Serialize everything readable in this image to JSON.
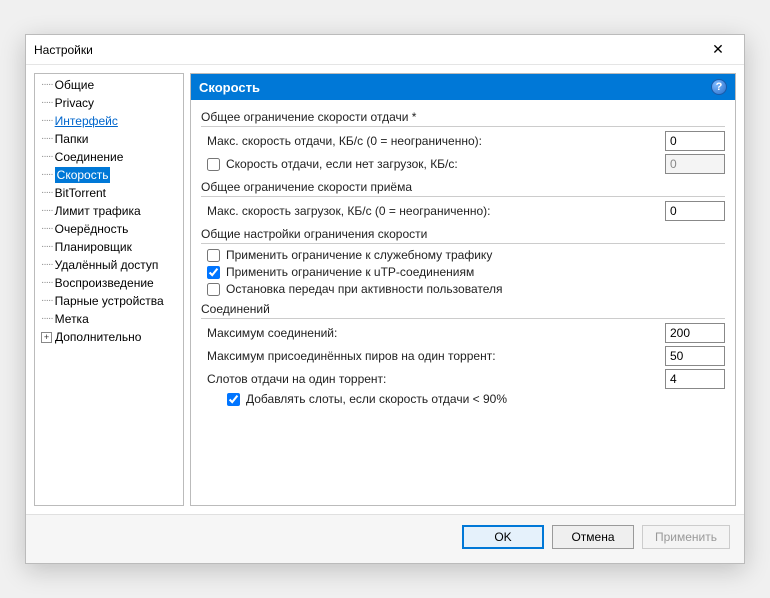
{
  "window": {
    "title": "Настройки",
    "close_glyph": "✕"
  },
  "tree": {
    "items": [
      {
        "label": "Общие",
        "kind": "normal"
      },
      {
        "label": "Privacy",
        "kind": "normal"
      },
      {
        "label": "Интерфейс",
        "kind": "link"
      },
      {
        "label": "Папки",
        "kind": "normal"
      },
      {
        "label": "Соединение",
        "kind": "normal"
      },
      {
        "label": "Скорость",
        "kind": "selected"
      },
      {
        "label": "BitTorrent",
        "kind": "normal"
      },
      {
        "label": "Лимит трафика",
        "kind": "normal"
      },
      {
        "label": "Очерёдность",
        "kind": "normal"
      },
      {
        "label": "Планировщик",
        "kind": "normal"
      },
      {
        "label": "Удалённый доступ",
        "kind": "normal"
      },
      {
        "label": "Воспроизведение",
        "kind": "normal"
      },
      {
        "label": "Парные устройства",
        "kind": "normal"
      },
      {
        "label": "Метка",
        "kind": "normal"
      },
      {
        "label": "Дополнительно",
        "kind": "expandable"
      }
    ]
  },
  "panel": {
    "title": "Скорость",
    "help_glyph": "?",
    "groups": {
      "upload": {
        "title": "Общее ограничение скорости отдачи *",
        "max_label": "Макс. скорость отдачи, КБ/с (0 = неограниченно):",
        "max_value": "0",
        "alt_checkbox_label": "Скорость отдачи, если нет загрузок, КБ/с:",
        "alt_checked": false,
        "alt_value": "0"
      },
      "download": {
        "title": "Общее ограничение скорости приёма",
        "max_label": "Макс. скорость загрузок, КБ/с (0 = неограниченно):",
        "max_value": "0"
      },
      "settings": {
        "title": "Общие настройки ограничения скорости",
        "overhead_label": "Применить ограничение к служебному трафику",
        "overhead_checked": false,
        "utp_label": "Применить ограничение к uTP-соединениям",
        "utp_checked": true,
        "pause_label": "Остановка передач при активности пользователя",
        "pause_checked": false
      },
      "connections": {
        "title": "Соединений",
        "max_conn_label": "Максимум соединений:",
        "max_conn_value": "200",
        "max_peers_label": "Максимум присоединённых пиров на один торрент:",
        "max_peers_value": "50",
        "slots_label": "Слотов отдачи на один торрент:",
        "slots_value": "4",
        "add_slots_label": "Добавлять слоты, если скорость отдачи < 90%",
        "add_slots_checked": true
      }
    }
  },
  "footer": {
    "ok": "OK",
    "cancel": "Отмена",
    "apply": "Применить"
  }
}
